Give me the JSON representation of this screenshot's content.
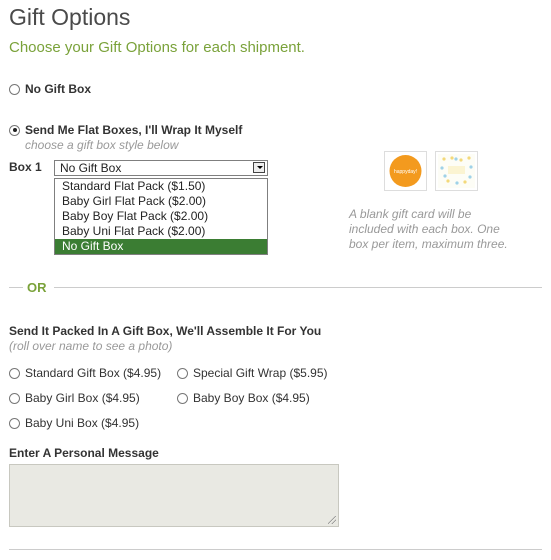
{
  "header": {
    "title": "Gift Options",
    "subtitle": "Choose your Gift Options for each shipment."
  },
  "options": {
    "no_gift_box": "No Gift Box",
    "flat_boxes": "Send Me Flat Boxes, I'll Wrap It Myself",
    "flat_boxes_hint": "choose a gift box style below"
  },
  "box_select": {
    "label": "Box 1",
    "value": "No Gift Box",
    "items": [
      "Standard Flat Pack ($1.50)",
      "Baby Girl Flat Pack ($2.00)",
      "Baby Boy Flat Pack ($2.00)",
      "Baby Uni Flat Pack ($2.00)",
      "No Gift Box"
    ]
  },
  "card_thumbs": {
    "sticker_text": "happyday!"
  },
  "card_note": "A blank gift card will be included with each box. One box per item, maximum three.",
  "divider": {
    "or_label": "OR"
  },
  "assembled": {
    "title": "Send It Packed In A Gift Box, We'll Assemble It For You",
    "hint": "(roll over name to see a photo)",
    "choices": {
      "standard": "Standard Gift Box ($4.95)",
      "special": "Special Gift Wrap ($5.95)",
      "girl": "Baby Girl Box ($4.95)",
      "boy": "Baby Boy Box ($4.95)",
      "uni": "Baby Uni Box ($4.95)"
    }
  },
  "message": {
    "label": "Enter A Personal Message",
    "value": ""
  },
  "colors": {
    "accent_green": "#7aa23a",
    "selected_green": "#3b7d33",
    "sticker_orange": "#f39a1e"
  }
}
